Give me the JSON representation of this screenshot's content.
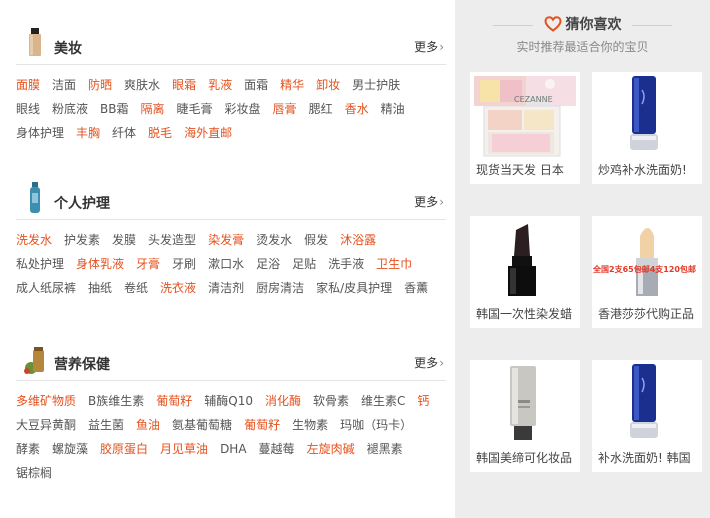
{
  "sections": [
    {
      "title": "美妆",
      "more": "更多",
      "tags": [
        {
          "t": "面膜",
          "hot": true
        },
        {
          "t": "洁面",
          "hot": false
        },
        {
          "t": "防晒",
          "hot": true
        },
        {
          "t": "爽肤水",
          "hot": false
        },
        {
          "t": "眼霜",
          "hot": true
        },
        {
          "t": "乳液",
          "hot": true
        },
        {
          "t": "面霜",
          "hot": false
        },
        {
          "t": "精华",
          "hot": true
        },
        {
          "t": "卸妆",
          "hot": true
        },
        {
          "t": "男士护肤",
          "hot": false
        },
        {
          "t": "眼线",
          "hot": false
        },
        {
          "t": "粉底液",
          "hot": false
        },
        {
          "t": "BB霜",
          "hot": false
        },
        {
          "t": "隔离",
          "hot": true
        },
        {
          "t": "睫毛膏",
          "hot": false
        },
        {
          "t": "彩妆盘",
          "hot": false
        },
        {
          "t": "唇膏",
          "hot": true
        },
        {
          "t": "腮红",
          "hot": false
        },
        {
          "t": "香水",
          "hot": true
        },
        {
          "t": "精油",
          "hot": false
        },
        {
          "t": "身体护理",
          "hot": false
        },
        {
          "t": "丰胸",
          "hot": true
        },
        {
          "t": "纤体",
          "hot": false
        },
        {
          "t": "脱毛",
          "hot": true
        },
        {
          "t": "海外直邮",
          "hot": true
        }
      ]
    },
    {
      "title": "个人护理",
      "more": "更多",
      "tags": [
        {
          "t": "洗发水",
          "hot": true
        },
        {
          "t": "护发素",
          "hot": false
        },
        {
          "t": "发膜",
          "hot": false
        },
        {
          "t": "头发造型",
          "hot": false
        },
        {
          "t": "染发膏",
          "hot": true
        },
        {
          "t": "烫发水",
          "hot": false
        },
        {
          "t": "假发",
          "hot": false
        },
        {
          "t": "沐浴露",
          "hot": true
        },
        {
          "t": "私处护理",
          "hot": false
        },
        {
          "t": "身体乳液",
          "hot": true
        },
        {
          "t": "牙膏",
          "hot": true
        },
        {
          "t": "牙刷",
          "hot": false
        },
        {
          "t": "漱口水",
          "hot": false
        },
        {
          "t": "足浴",
          "hot": false
        },
        {
          "t": "足贴",
          "hot": false
        },
        {
          "t": "洗手液",
          "hot": false
        },
        {
          "t": "卫生巾",
          "hot": true
        },
        {
          "t": "成人纸尿裤",
          "hot": false
        },
        {
          "t": "抽纸",
          "hot": false
        },
        {
          "t": "卷纸",
          "hot": false
        },
        {
          "t": "洗衣液",
          "hot": true
        },
        {
          "t": "清洁剂",
          "hot": false
        },
        {
          "t": "厨房清洁",
          "hot": false
        },
        {
          "t": "家私/皮具护理",
          "hot": false
        },
        {
          "t": "香薰",
          "hot": false
        }
      ]
    },
    {
      "title": "营养保健",
      "more": "更多",
      "tags": [
        {
          "t": "多维矿物质",
          "hot": true
        },
        {
          "t": "B族维生素",
          "hot": false
        },
        {
          "t": "葡萄籽",
          "hot": true
        },
        {
          "t": "辅酶Q10",
          "hot": false
        },
        {
          "t": "消化酶",
          "hot": true
        },
        {
          "t": "软骨素",
          "hot": false
        },
        {
          "t": "维生素C",
          "hot": false
        },
        {
          "t": "钙",
          "hot": true
        },
        {
          "t": "大豆异黄酮",
          "hot": false
        },
        {
          "t": "益生菌",
          "hot": false
        },
        {
          "t": "鱼油",
          "hot": true
        },
        {
          "t": "氨基葡萄糖",
          "hot": false
        },
        {
          "t": "葡萄籽",
          "hot": true
        },
        {
          "t": "生物素",
          "hot": false
        },
        {
          "t": "玛咖（玛卡）",
          "hot": false
        },
        {
          "t": "酵素",
          "hot": false
        },
        {
          "t": "螺旋藻",
          "hot": false
        },
        {
          "t": "胶原蛋白",
          "hot": true
        },
        {
          "t": "月见草油",
          "hot": true
        },
        {
          "t": "DHA",
          "hot": false
        },
        {
          "t": "蔓越莓",
          "hot": false
        },
        {
          "t": "左旋肉碱",
          "hot": true
        },
        {
          "t": "褪黑素",
          "hot": false
        },
        {
          "t": "锯棕榈",
          "hot": false
        }
      ]
    }
  ],
  "guess": {
    "title": "猜你喜欢",
    "subtitle": "实时推荐最适合你的宝贝",
    "items": [
      {
        "caption": "现货当天发 日本",
        "img_text": "CEZANNE"
      },
      {
        "caption": "炒鸡补水洗面奶!",
        "img_text": ""
      },
      {
        "caption": "韩国一次性染发蜡",
        "img_text": ""
      },
      {
        "caption": "香港莎莎代购正品",
        "img_text": "全国2支65包邮4支120包邮"
      },
      {
        "caption": "韩国美缔可化妆品",
        "img_text": ""
      },
      {
        "caption": "补水洗面奶! 韩国",
        "img_text": ""
      }
    ]
  },
  "colors": {
    "hot": "#e5511d",
    "heart": "#e5511d",
    "bg_right": "#ededed"
  }
}
